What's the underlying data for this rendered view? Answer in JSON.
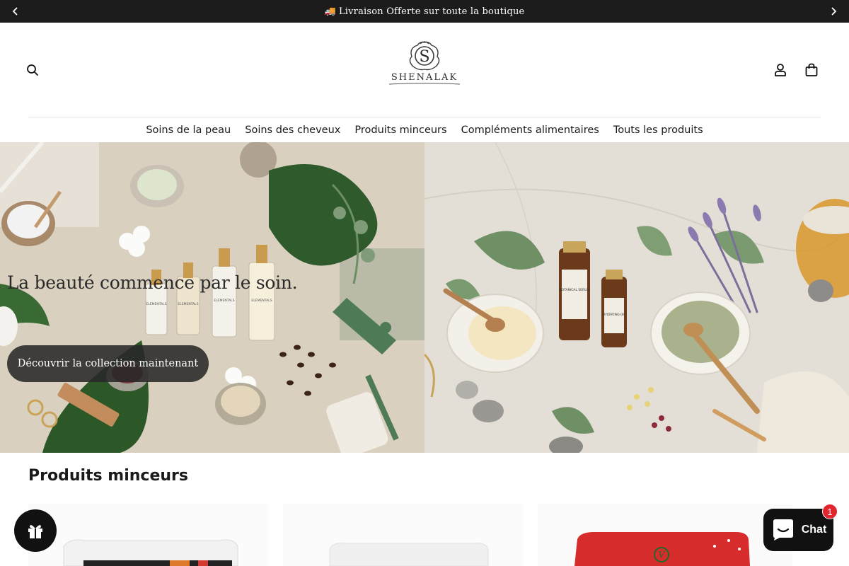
{
  "announcement": {
    "icon": "truck-icon",
    "text": "Livraison Offerte sur toute la boutique"
  },
  "header": {
    "logo_text": "SHENALAK",
    "logo_monogram": "S"
  },
  "nav": {
    "items": [
      {
        "label": "Soins de la peau"
      },
      {
        "label": "Soins des cheveux"
      },
      {
        "label": "Produits minceurs"
      },
      {
        "label": "Compléments alimentaires"
      },
      {
        "label": "Touts les produits"
      }
    ]
  },
  "hero": {
    "heading": "La beauté commence par le soin.",
    "cta_label": "Découvrir la collection maintenant",
    "bottle_labels": [
      "ELEMENTALS",
      "ELEMENTALS",
      "ELEMENTALS",
      "ELEMENTALS"
    ],
    "serum_label": "BOTANICAL SERUM",
    "oil_label": "HYDRATING OIL"
  },
  "section": {
    "title": "Produits minceurs"
  },
  "chat": {
    "label": "Chat",
    "badge_count": "1"
  },
  "colors": {
    "announcement_bg": "#1c1c1c",
    "cta_bg": "#282828",
    "chat_badge": "#e0262f"
  }
}
